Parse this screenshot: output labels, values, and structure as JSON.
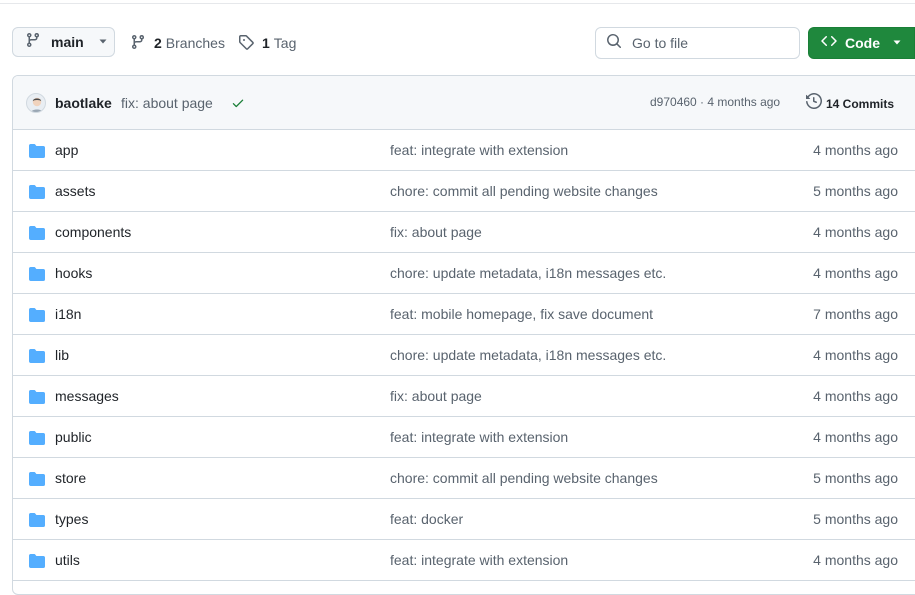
{
  "branch": {
    "name": "main"
  },
  "meta": {
    "branches_count": "2",
    "branches_label": "Branches",
    "tags_count": "1",
    "tags_label": "Tag"
  },
  "search": {
    "placeholder": "Go to file"
  },
  "code_button": {
    "label": "Code",
    "color": "#1f883d"
  },
  "latest_commit": {
    "author": "baotlake",
    "message": "fix: about page",
    "status": "success",
    "hash": "d970460",
    "age": "4 months ago",
    "hash_age": "d970460 · 4 months ago",
    "commits_label": "14 Commits"
  },
  "files": [
    {
      "name": "app",
      "message": "feat: integrate with extension",
      "age": "4 months ago",
      "type": "folder"
    },
    {
      "name": "assets",
      "message": "chore: commit all pending website changes",
      "age": "5 months ago",
      "type": "folder"
    },
    {
      "name": "components",
      "message": "fix: about page",
      "age": "4 months ago",
      "type": "folder"
    },
    {
      "name": "hooks",
      "message": "chore: update metadata, i18n messages etc.",
      "age": "4 months ago",
      "type": "folder"
    },
    {
      "name": "i18n",
      "message": "feat: mobile homepage, fix save document",
      "age": "7 months ago",
      "type": "folder"
    },
    {
      "name": "lib",
      "message": "chore: update metadata, i18n messages etc.",
      "age": "4 months ago",
      "type": "folder"
    },
    {
      "name": "messages",
      "message": "fix: about page",
      "age": "4 months ago",
      "type": "folder"
    },
    {
      "name": "public",
      "message": "feat: integrate with extension",
      "age": "4 months ago",
      "type": "folder"
    },
    {
      "name": "store",
      "message": "chore: commit all pending website changes",
      "age": "5 months ago",
      "type": "folder"
    },
    {
      "name": "types",
      "message": "feat: docker",
      "age": "5 months ago",
      "type": "folder"
    },
    {
      "name": "utils",
      "message": "feat: integrate with extension",
      "age": "4 months ago",
      "type": "folder"
    }
  ],
  "colors": {
    "folder": "#54aeff",
    "success": "#1a7f37",
    "muted": "#59636e",
    "border": "#d1d9e0"
  }
}
